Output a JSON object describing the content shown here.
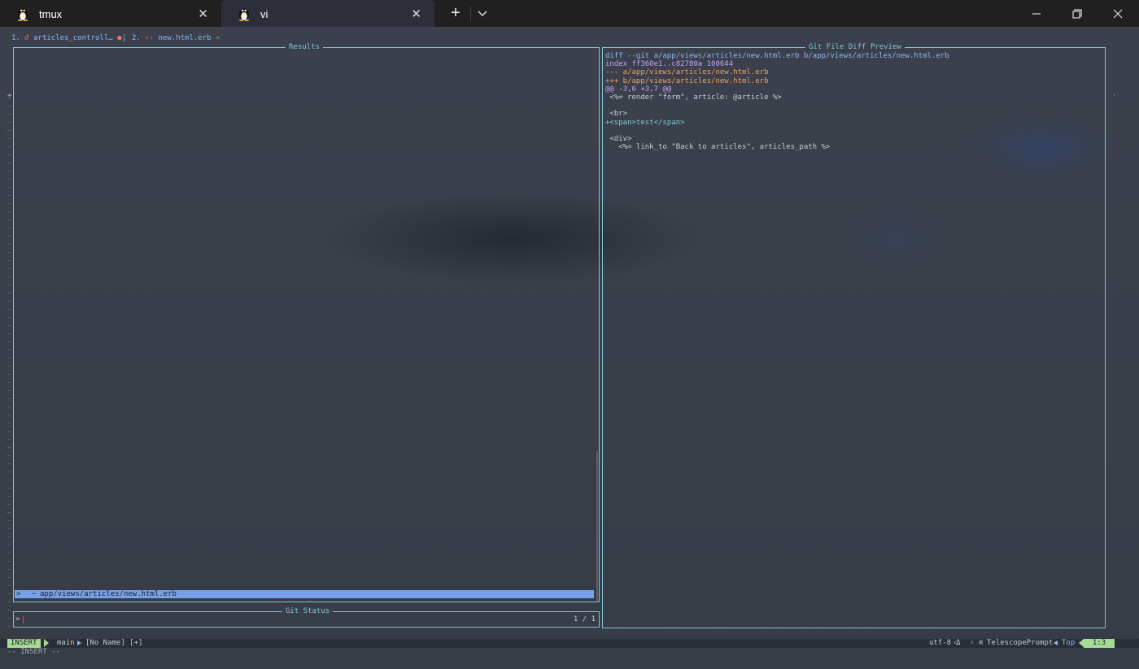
{
  "window": {
    "tabs": [
      {
        "label": "tmux",
        "icon": "tux-icon"
      },
      {
        "label": "vi",
        "icon": "tux-icon"
      }
    ],
    "new_tab_label": "+"
  },
  "bufferline": {
    "items": [
      {
        "number": "1.",
        "name": "articles_controll…",
        "icon": "ruby-icon"
      },
      {
        "number": "2.",
        "name": "new.html.erb",
        "icon": "erb-icon"
      }
    ],
    "separator": "|",
    "close_glyph": "×",
    "modified_glyph": "●"
  },
  "telescope": {
    "results_title": "Results",
    "prompt_title": "Git Status",
    "preview_title": "Git File Diff Preview",
    "selected_caret": ">",
    "selected_entry": "app/views/articles/new.html.erb",
    "prompt_prefix": ">",
    "counter": "1 / 1",
    "diff_lines": [
      {
        "kind": "head",
        "text": "diff --git a/app/views/articles/new.html.erb b/app/views/articles/new.html.erb"
      },
      {
        "kind": "index",
        "text": "index ff360e1..c82780a 100644"
      },
      {
        "kind": "file",
        "text": "--- a/app/views/articles/new.html.erb"
      },
      {
        "kind": "file",
        "text": "+++ b/app/views/articles/new.html.erb"
      },
      {
        "kind": "hunk",
        "text": "@@ -3,6 +3,7 @@"
      },
      {
        "kind": "ctx",
        "text": " <%= render \"form\", article: @article %>"
      },
      {
        "kind": "ctx",
        "text": ""
      },
      {
        "kind": "ctx",
        "text": " <br>"
      },
      {
        "kind": "add",
        "text": "+<span>test</span>"
      },
      {
        "kind": "ctx",
        "text": ""
      },
      {
        "kind": "ctx",
        "text": " <div>"
      },
      {
        "kind": "ctx",
        "text": "   <%= link_to \"Back to articles\", articles_path %>"
      }
    ]
  },
  "statusline": {
    "mode": "INSERT",
    "branch_icon": "",
    "branch": "main",
    "filename": "[No Name] [+]",
    "encoding": "utf-8",
    "format_icon": "Δ",
    "filetype_icon": "≡",
    "filetype": "TelescopePrompt",
    "scroll": "Top",
    "position": "1:3"
  },
  "cmdline": "-- INSERT --",
  "colors": {
    "border": "#7ec8d8",
    "selection": "#78a0e8",
    "mode_bg": "#a6da95",
    "diff_add": "#7ec8d8",
    "diff_file": "#eda060",
    "diff_meta": "#c6a0f6"
  }
}
